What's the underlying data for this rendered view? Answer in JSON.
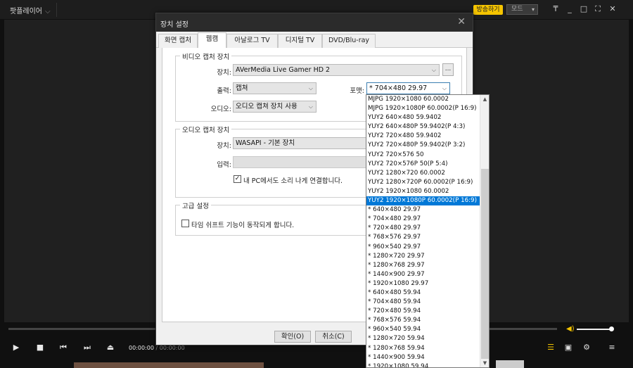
{
  "app": {
    "title": "팟플레이어",
    "broadcast_label": "방송하기",
    "mode_label": "모드"
  },
  "window_controls": [
    "pin-icon",
    "minimize-icon",
    "maximize-icon",
    "fullscreen-icon",
    "close-icon"
  ],
  "dialog": {
    "title": "장치 설정",
    "tabs": [
      "화면 캡처",
      "웹캠",
      "아날로그 TV",
      "디지털 TV",
      "DVD/Blu-ray"
    ],
    "active_tab": 1,
    "video": {
      "legend": "비디오 캡처 장치",
      "device_label": "장치:",
      "device_value": "AVerMedia Live Gamer HD 2",
      "more_label": "...",
      "output_label": "출력:",
      "output_value": "캡쳐",
      "format_label": "포맷:",
      "format_value": "* 704×480 29.97",
      "audio_label": "오디오:",
      "audio_value": "오디오 캡쳐 장치 사용"
    },
    "audio_capture": {
      "legend": "오디오 캡처 장치",
      "device_label": "장치:",
      "device_value": "WASAPI - 기본 장치",
      "input_label": "입력:",
      "connect_checked": true,
      "connect_label": "내 PC에서도 소리 나게 연결합니다."
    },
    "advanced": {
      "legend": "고급 설정",
      "timeshift_checked": false,
      "timeshift_label": "타임 쉬프트 기능이 동작되게 합니다."
    },
    "ok_label": "확인(O)",
    "cancel_label": "취소(C)"
  },
  "format_dropdown": {
    "selected_index": 11,
    "items": [
      "MJPG 1920×1080 60.0002",
      "MJPG 1920×1080P 60.0002(P 16:9)",
      "YUY2 640×480 59.9402",
      "YUY2 640×480P 59.9402(P 4:3)",
      "YUY2 720×480 59.9402",
      "YUY2 720×480P 59.9402(P 3:2)",
      "YUY2 720×576 50",
      "YUY2 720×576P 50(P 5:4)",
      "YUY2 1280×720 60.0002",
      "YUY2 1280×720P 60.0002(P 16:9)",
      "YUY2 1920×1080 60.0002",
      "YUY2 1920×1080P 60.0002(P 16:9)",
      "* 640×480 29.97",
      "* 704×480 29.97",
      "* 720×480 29.97",
      "* 768×576 29.97",
      "* 960×540 29.97",
      "* 1280×720 29.97",
      "* 1280×768 29.97",
      "* 1440×900 29.97",
      "* 1920×1080 29.97",
      "* 640×480 59.94",
      "* 704×480 59.94",
      "* 720×480 59.94",
      "* 768×576 59.94",
      "* 960×540 59.94",
      "* 1280×720 59.94",
      "* 1280×768 59.94",
      "* 1440×900 59.94",
      "* 1920×1080 59.94"
    ]
  },
  "player": {
    "time_current": "00:00:00",
    "time_total": "00:00:00",
    "volume": 1.0
  },
  "colors": {
    "accent": "#f5c400",
    "selection": "#0078d7"
  }
}
